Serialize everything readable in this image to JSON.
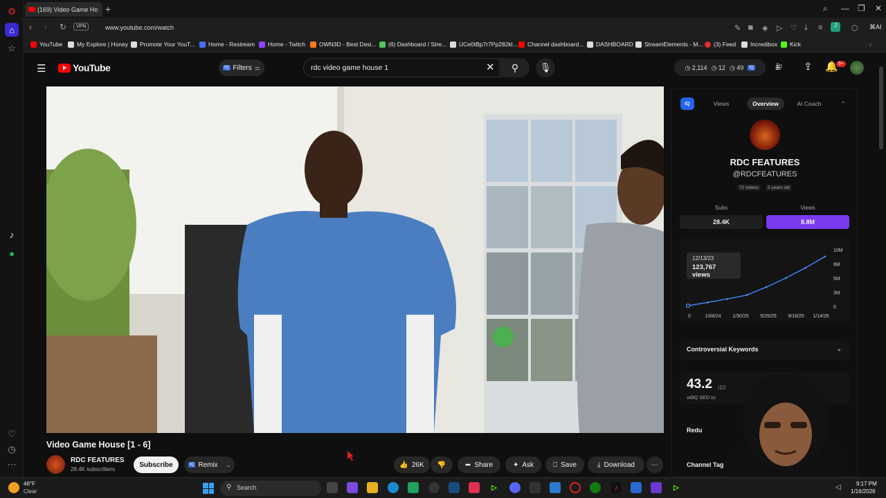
{
  "browser": {
    "tab_title": "(169) Video Game Ho",
    "new_tab": "+",
    "vpn_label": "VPN",
    "url": "www.youtube.com/watch",
    "bookmarks": [
      {
        "label": "YouTube",
        "color": "#ff0000"
      },
      {
        "label": "My Explore | Honey",
        "color": "#dddddd"
      },
      {
        "label": "Promote Your YouT...",
        "color": "#dddddd"
      },
      {
        "label": "Home - Restream",
        "color": "#4a6cf7"
      },
      {
        "label": "Home - Twitch",
        "color": "#9146ff"
      },
      {
        "label": "OWN3D - Best Desi...",
        "color": "#ff7a1a"
      },
      {
        "label": "(6) Dashboard / Stre...",
        "color": "#53c35a"
      },
      {
        "label": "UCe0tBp7r7Pp282kl...",
        "color": "#dddddd"
      },
      {
        "label": "Channel dashboard...",
        "color": "#ff0000"
      },
      {
        "label": "DASHBOARD",
        "color": "#dddddd"
      },
      {
        "label": "StreamElements - M...",
        "color": "#dddddd"
      },
      {
        "label": "(3) Feed",
        "color": "#e03030"
      },
      {
        "label": "Incredibox",
        "color": "#dddddd"
      },
      {
        "label": "Kick",
        "color": "#53fc18"
      }
    ]
  },
  "youtube": {
    "logo_text": "YouTube",
    "filters_iq": "IQ",
    "filters_label": "Filters",
    "search_value": "rdc video game house 1",
    "stats": {
      "views": "2,114",
      "likes": "12",
      "subs": "49",
      "iq": "IQ"
    },
    "notif_count": "9+"
  },
  "video": {
    "title": "Video Game House [1 - 6]",
    "channel_name": "RDC FEATURES",
    "channel_subs": "28.4K subscribers",
    "subscribe_label": "Subscribe",
    "remix_label": "Remix",
    "remix_iq": "IQ",
    "like_count": "26K",
    "share_label": "Share",
    "ask_label": "Ask",
    "save_label": "Save",
    "download_label": "Download"
  },
  "vidiq": {
    "iq": "IQ",
    "tabs": [
      "Views",
      "Overview",
      "AI Coach"
    ],
    "channel_name": "RDC FEATURES",
    "handle": "@RDCFEATURES",
    "videos_pill": "72 videos",
    "age_pill": "5 years old",
    "subs_label": "Subs",
    "views_label": "Views",
    "subs_value": "28.4K",
    "views_value": "8.8M",
    "tooltip_date": "12/13/23",
    "tooltip_views": "123,767 views",
    "controversial_label": "Controversial Keywords",
    "seo_score": "43.2",
    "seo_denom": "/10",
    "seo_label": "vidIQ SEO sc",
    "reduce_label": "Redu",
    "tags_label": "Channel Tags"
  },
  "chart_data": {
    "type": "line",
    "title": "",
    "xlabel": "",
    "ylabel": "",
    "x_ticks": [
      "0",
      "10/8/24",
      "1/30/25",
      "5/25/25",
      "9/16/25",
      "1/14/26"
    ],
    "y_ticks": [
      "10M",
      "8M",
      "5M",
      "3M",
      "0"
    ],
    "ylim": [
      0,
      10000000
    ],
    "series": [
      {
        "x": [
          "12/13/23",
          "3/1/24",
          "6/1/24",
          "10/8/24",
          "1/30/25",
          "5/25/25",
          "9/16/25",
          "1/14/26"
        ],
        "values": [
          123767,
          700000,
          1300000,
          2000000,
          3400000,
          5000000,
          6800000,
          8800000
        ]
      }
    ],
    "grid": false
  },
  "taskbar": {
    "temp": "46°F",
    "weather": "Clear",
    "search_placeholder": "Search",
    "time": "9:17 PM",
    "date": "1/16/2026"
  },
  "colors": {
    "accent": "#7c3aed",
    "youtube_red": "#ff0000",
    "vidiq_blue": "#2563eb"
  }
}
